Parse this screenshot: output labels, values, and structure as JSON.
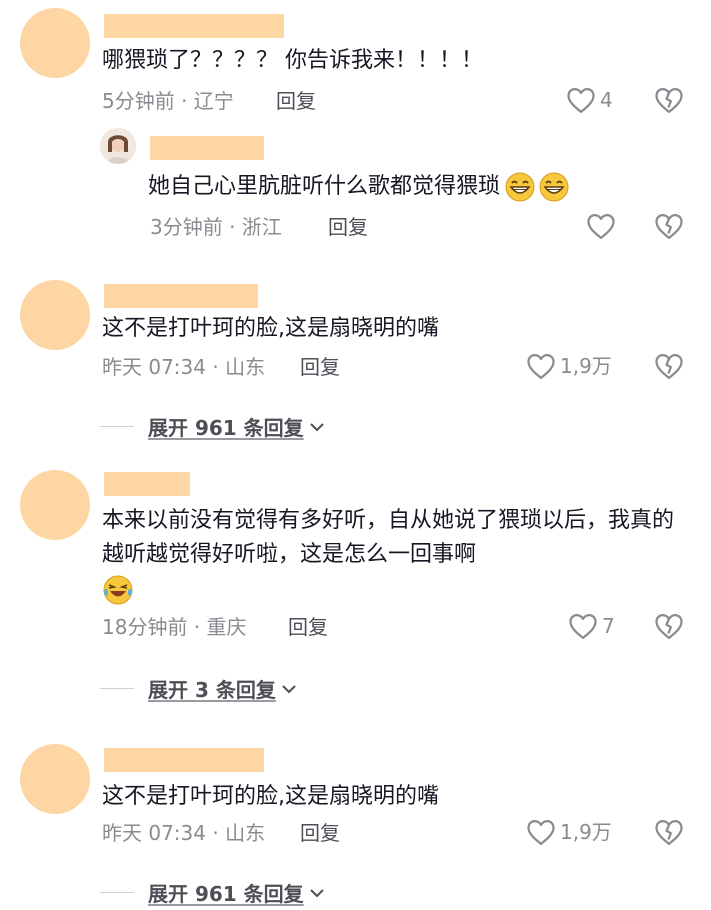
{
  "colors": {
    "avatar": "#fdd6a3",
    "name_bar": "#fdd6a3",
    "icon": "#8a8b91"
  },
  "comments": [
    {
      "text": "哪猥琐了？？？？ 你告诉我来！！！！",
      "meta": "5分钟前 · 辽宁",
      "reply_label": "回复",
      "likes": "4",
      "sub_reply": {
        "text": "她自己心里肮脏听什么歌都觉得猥琐",
        "emoji": [
          "grin-emoji",
          "grin-emoji"
        ],
        "meta": "3分钟前 · 浙江",
        "reply_label": "回复",
        "likes": ""
      }
    },
    {
      "text": "这不是打叶珂的脸,这是扇晓明的嘴",
      "meta": "昨天 07:34 · 山东",
      "reply_label": "回复",
      "likes": "1,9万",
      "expand_label": "展开 961 条回复"
    },
    {
      "text": "本来以前没有觉得有多好听，自从她说了猥琐以后，我真的越听越觉得好听啦，这是怎么一回事啊",
      "emoji": "laugh-cry-emoji",
      "meta": "18分钟前 · 重庆",
      "reply_label": "回复",
      "likes": "7",
      "expand_label": "展开 3 条回复"
    },
    {
      "text": "这不是打叶珂的脸,这是扇晓明的嘴",
      "meta": "昨天 07:34 · 山东",
      "reply_label": "回复",
      "likes": "1,9万",
      "expand_label": "展开 961 条回复"
    }
  ]
}
